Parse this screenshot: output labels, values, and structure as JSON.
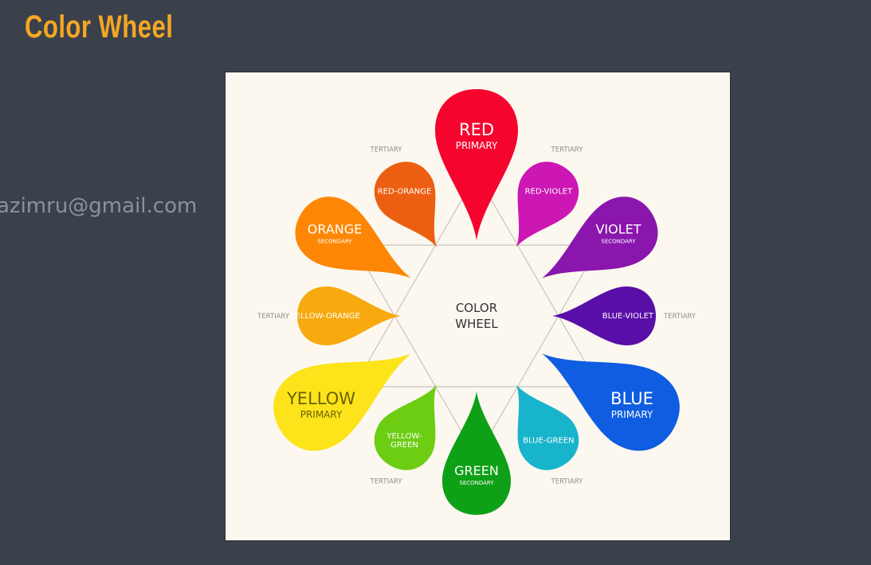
{
  "page": {
    "title": "Color Wheel",
    "watermark": "azimru@gmail.com"
  },
  "wheel": {
    "center_line1": "COLOR",
    "center_line2": "WHEEL",
    "tertiary_label": "TERTIARY",
    "petals": [
      {
        "id": "red",
        "name": "RED",
        "sub": "PRIMARY",
        "color": "#f5052d"
      },
      {
        "id": "red-violet",
        "name": "RED-VIOLET",
        "sub": "",
        "color": "#cc17b4"
      },
      {
        "id": "violet",
        "name": "VIOLET",
        "sub": "SECONDARY",
        "color": "#8a16ad"
      },
      {
        "id": "blue-violet",
        "name": "BLUE-VIOLET",
        "sub": "",
        "color": "#5a0ea8"
      },
      {
        "id": "blue",
        "name": "BLUE",
        "sub": "PRIMARY",
        "color": "#0f5de0"
      },
      {
        "id": "blue-green",
        "name": "BLUE-GREEN",
        "sub": "",
        "color": "#18b4cc"
      },
      {
        "id": "green",
        "name": "GREEN",
        "sub": "SECONDARY",
        "color": "#0ea016"
      },
      {
        "id": "yellow-green",
        "name": "YELLOW-GREEN",
        "sub": "",
        "color": "#6ccd12"
      },
      {
        "id": "yellow",
        "name": "YELLOW",
        "sub": "PRIMARY",
        "color": "#fde31a"
      },
      {
        "id": "yellow-orange",
        "name": "YELLOW-ORANGE",
        "sub": "",
        "color": "#f6aa0f"
      },
      {
        "id": "orange",
        "name": "ORANGE",
        "sub": "SECONDARY",
        "color": "#fd8705"
      },
      {
        "id": "red-orange",
        "name": "RED-ORANGE",
        "sub": "",
        "color": "#ec5f12"
      }
    ]
  }
}
